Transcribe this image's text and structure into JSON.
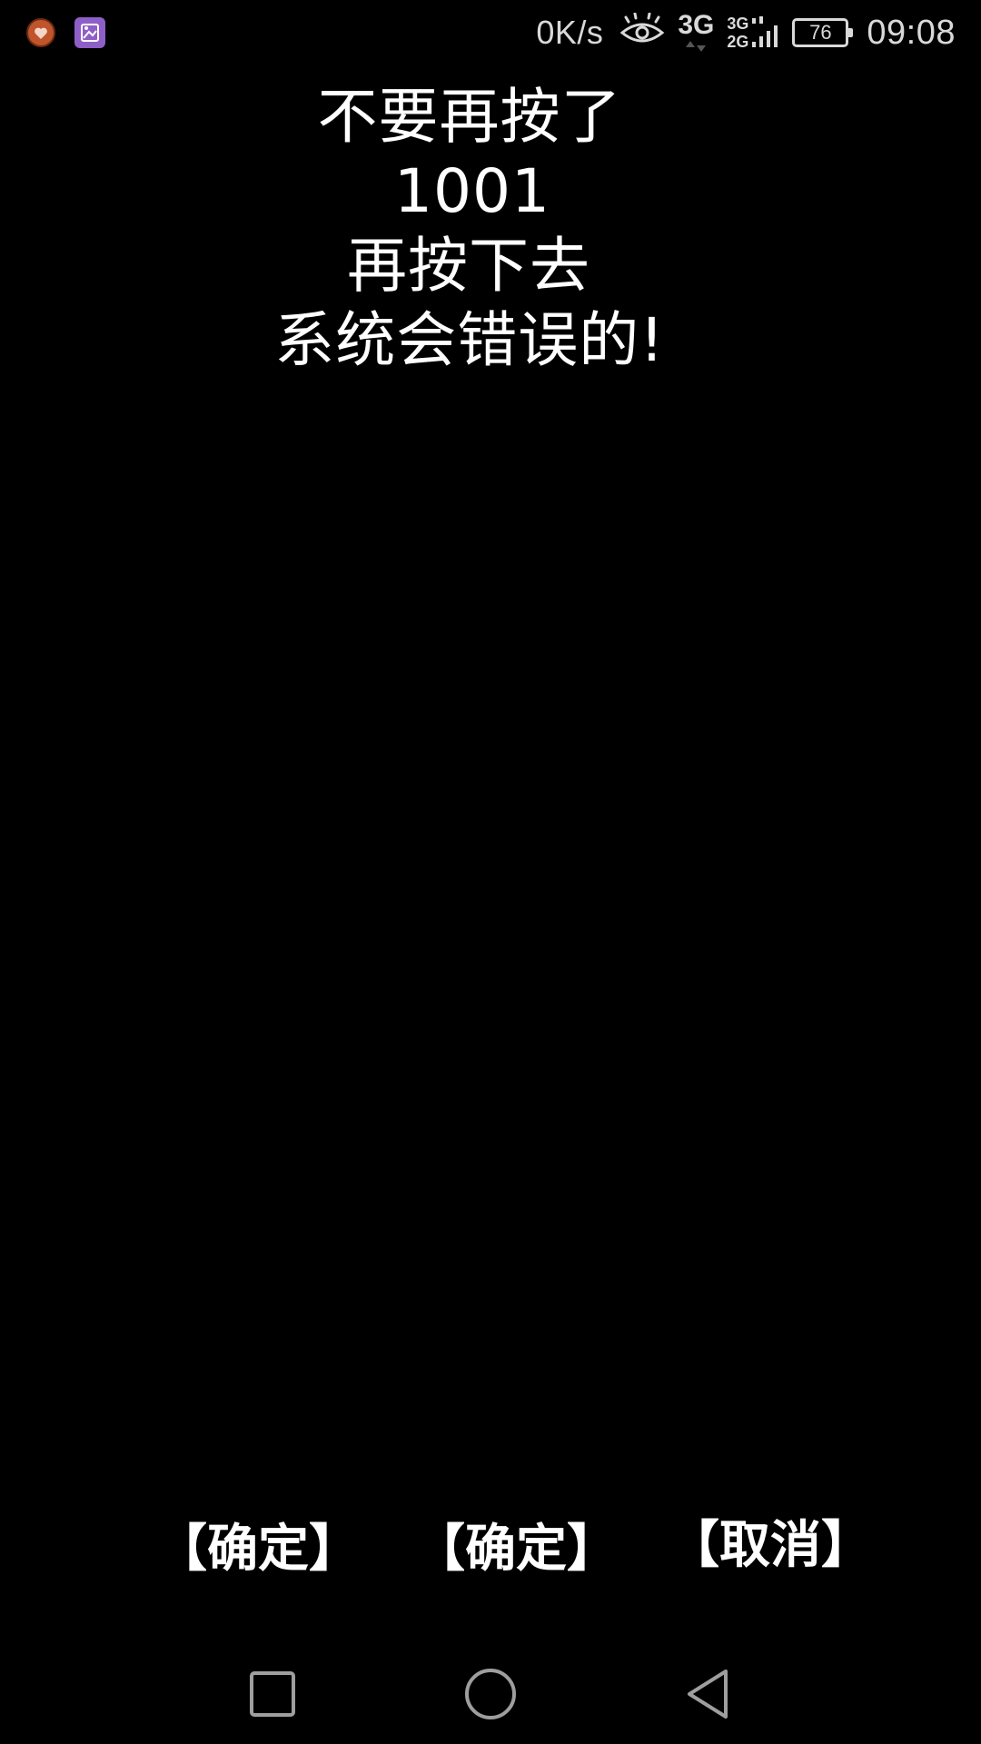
{
  "status_bar": {
    "notification_icons": [
      "heart-app-icon",
      "gallery-app-icon"
    ],
    "net_speed": "0K/s",
    "eye_icon": "eye-comfort-icon",
    "network_primary": "3G",
    "network_secondary_top": "3G",
    "network_secondary_bottom": "2G",
    "battery_level": "76",
    "time": "09:08"
  },
  "message": {
    "line1": "不要再按了",
    "line2": "1001",
    "line3": "再按下去",
    "line4": "系统会错误的!"
  },
  "actions": {
    "confirm_1": "【确定】",
    "confirm_2": "【确定】",
    "cancel": "【取消】"
  },
  "nav_bar": {
    "recent_icon": "square-recent-apps-icon",
    "home_icon": "circle-home-icon",
    "back_icon": "triangle-back-icon"
  },
  "colors": {
    "background": "#000000",
    "text": "#ffffff",
    "status_text": "#d9d9d9",
    "nav_icon": "#9e9e9e",
    "gallery_icon": "#8e5fc7",
    "heart_icon": "#c0542a"
  }
}
